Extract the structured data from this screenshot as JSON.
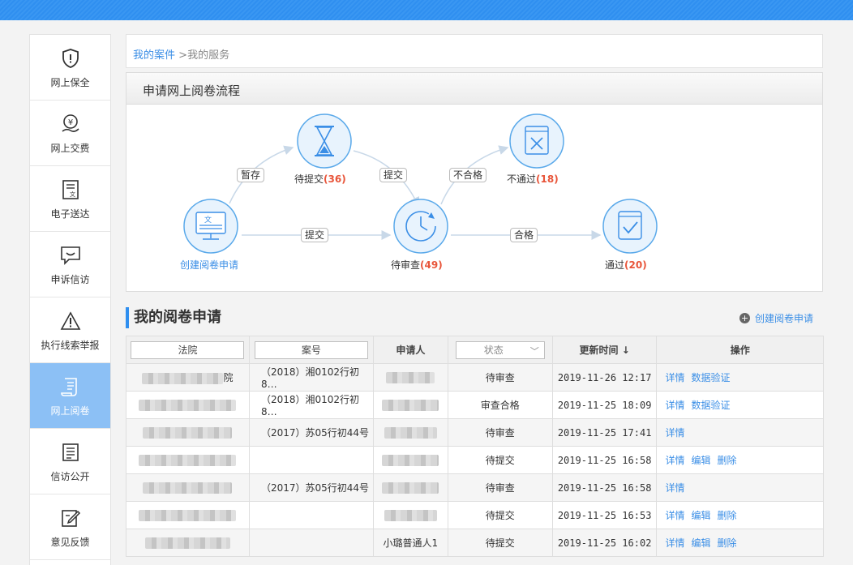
{
  "sidebar": {
    "items": [
      {
        "label": "网上保全",
        "icon": "shield-icon"
      },
      {
        "label": "网上交费",
        "icon": "yen-hand-icon"
      },
      {
        "label": "电子送达",
        "icon": "document-icon"
      },
      {
        "label": "申诉信访",
        "icon": "chat-icon"
      },
      {
        "label": "执行线索举报",
        "icon": "warning-icon"
      },
      {
        "label": "网上阅卷",
        "icon": "scroll-icon",
        "active": true
      },
      {
        "label": "信访公开",
        "icon": "list-doc-icon"
      },
      {
        "label": "意见反馈",
        "icon": "edit-icon"
      }
    ]
  },
  "breadcrumb": {
    "link": "我的案件",
    "sep": ">",
    "current": "我的服务"
  },
  "flow": {
    "title": "申请网上阅卷流程",
    "nodes": {
      "create": {
        "label": "创建阅卷申请",
        "icon": "document-monitor-icon"
      },
      "pending_submit": {
        "label": "待提交",
        "count": "(36)",
        "icon": "hourglass-icon"
      },
      "reviewing": {
        "label": "待审查",
        "count": "(49)",
        "icon": "clock-icon"
      },
      "rejected": {
        "label": "不通过",
        "count": "(18)",
        "icon": "reject-icon"
      },
      "passed": {
        "label": "通过",
        "count": "(20)",
        "icon": "check-icon"
      }
    },
    "edges": {
      "save": "暂存",
      "submit_top": "提交",
      "submit_bottom": "提交",
      "fail": "不合格",
      "pass": "合格"
    }
  },
  "section": {
    "title": "我的阅卷申请",
    "create_label": "创建阅卷申请"
  },
  "table": {
    "headers": {
      "court": "法院",
      "case_no": "案号",
      "applicant": "申请人",
      "status": "状态",
      "updated": "更新时间",
      "ops": "操作"
    },
    "sort_arrow": "↓",
    "rows": [
      {
        "court_suffix": "院",
        "case_no": "（2018）湘0102行初8…",
        "applicant": "",
        "status": "待审查",
        "updated": "2019-11-26 12:17",
        "ops": [
          "详情",
          "数据验证"
        ]
      },
      {
        "court_suffix": "",
        "case_no": "（2018）湘0102行初8…",
        "applicant": "",
        "status": "审查合格",
        "updated": "2019-11-25 18:09",
        "ops": [
          "详情",
          "数据验证"
        ]
      },
      {
        "court_suffix": "",
        "case_no": "（2017）苏05行初44号",
        "applicant": "",
        "status": "待审查",
        "updated": "2019-11-25 17:41",
        "ops": [
          "详情"
        ]
      },
      {
        "court_suffix": "",
        "case_no": "",
        "applicant": "",
        "status": "待提交",
        "updated": "2019-11-25 16:58",
        "ops": [
          "详情",
          "编辑",
          "删除"
        ]
      },
      {
        "court_suffix": "",
        "case_no": "（2017）苏05行初44号",
        "applicant": "",
        "status": "待审查",
        "updated": "2019-11-25 16:58",
        "ops": [
          "详情"
        ]
      },
      {
        "court_suffix": "",
        "case_no": "",
        "applicant": "",
        "status": "待提交",
        "updated": "2019-11-25 16:53",
        "ops": [
          "详情",
          "编辑",
          "删除"
        ]
      },
      {
        "court_suffix": "",
        "case_no": "",
        "applicant": "小璐普通人1",
        "status": "待提交",
        "updated": "2019-11-25 16:02",
        "ops": [
          "详情",
          "编辑",
          "删除"
        ]
      }
    ]
  },
  "colors": {
    "accent": "#2f8ff0",
    "link": "#3a8ee6",
    "count": "#e8553a",
    "sidebar_active": "#8cc0f5"
  }
}
